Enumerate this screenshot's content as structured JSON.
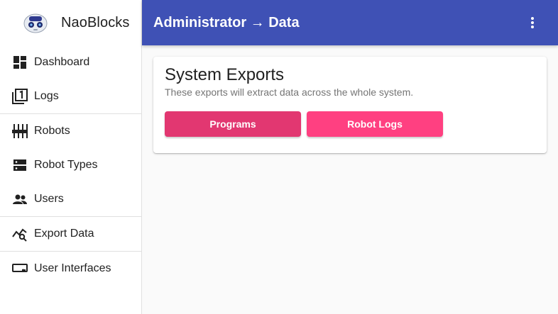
{
  "app": {
    "name": "NaoBlocks"
  },
  "topbar": {
    "title": "Administrator → Data",
    "menu_icon": "more-vert-icon"
  },
  "sidebar": {
    "items": [
      {
        "label": "Dashboard",
        "icon": "dashboard-icon"
      },
      {
        "label": "Logs",
        "icon": "logs-icon"
      },
      {
        "label": "Robots",
        "icon": "robots-icon"
      },
      {
        "label": "Robot Types",
        "icon": "robot-types-icon"
      },
      {
        "label": "Users",
        "icon": "users-icon"
      },
      {
        "label": "Export Data",
        "icon": "export-data-icon"
      },
      {
        "label": "User Interfaces",
        "icon": "user-interfaces-icon"
      }
    ]
  },
  "card": {
    "title": "System Exports",
    "subtitle": "These exports will extract data across the whole system.",
    "buttons": {
      "programs": "Programs",
      "robot_logs": "Robot Logs"
    }
  },
  "colors": {
    "primary": "#3f51b5",
    "accent": "#ff4081",
    "accent_dark": "#e23771"
  }
}
